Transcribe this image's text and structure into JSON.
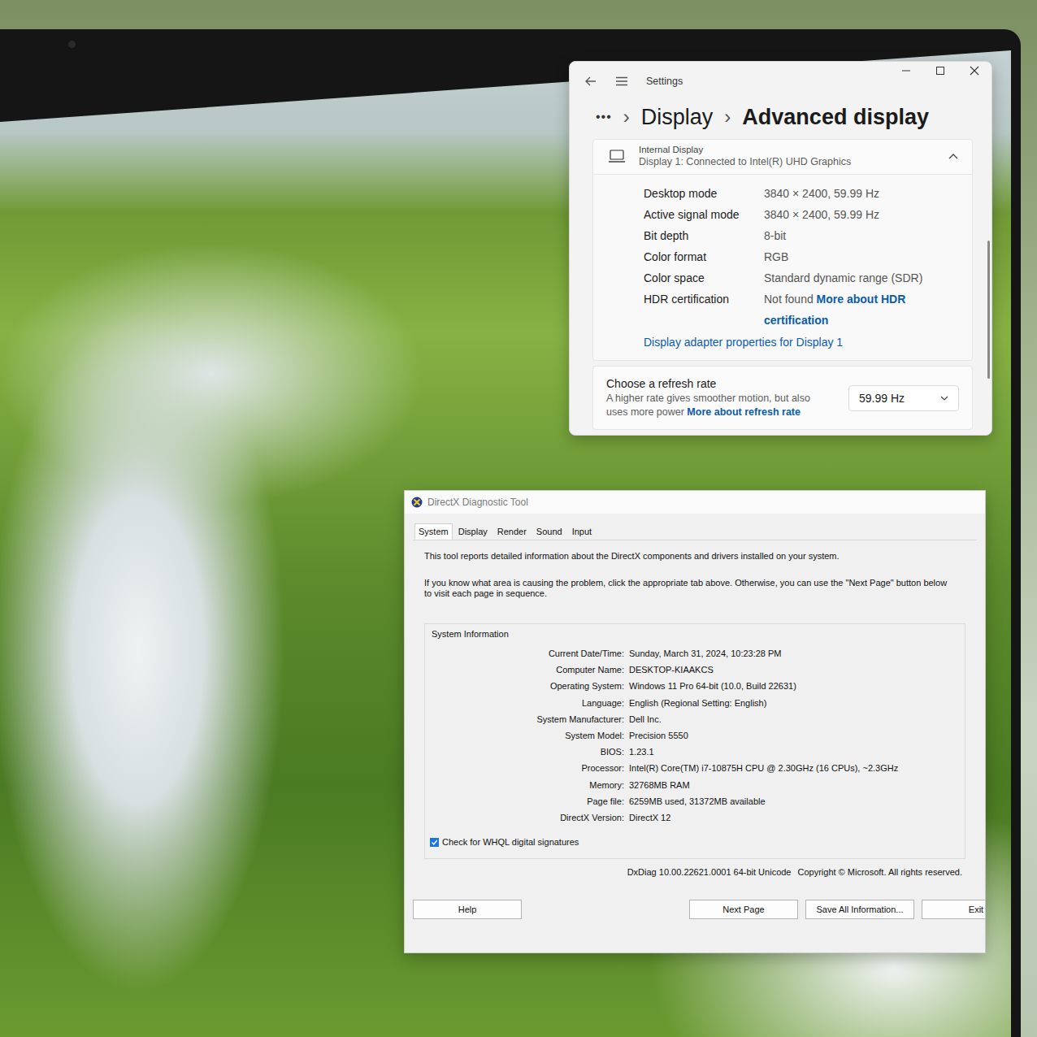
{
  "settings": {
    "title": "Settings",
    "breadcrumb": {
      "more": "•••",
      "separator": "›",
      "parent": "Display",
      "current": "Advanced display"
    },
    "display_card": {
      "title": "Internal Display",
      "subtitle": "Display 1: Connected to Intel(R) UHD Graphics",
      "expanded": true,
      "rows": [
        {
          "label": "Desktop mode",
          "value": "3840 × 2400, 59.99 Hz"
        },
        {
          "label": "Active signal mode",
          "value": "3840 × 2400, 59.99 Hz"
        },
        {
          "label": "Bit depth",
          "value": "8-bit"
        },
        {
          "label": "Color format",
          "value": "RGB"
        },
        {
          "label": "Color space",
          "value": "Standard dynamic range (SDR)"
        },
        {
          "label": "HDR certification",
          "value": "Not found",
          "link": "More about HDR certification"
        }
      ],
      "adapter_link": "Display adapter properties for Display 1"
    },
    "refresh": {
      "title": "Choose a refresh rate",
      "description": "A higher rate gives smoother motion, but also uses more power",
      "link": "More about refresh rate",
      "value": "59.99 Hz"
    }
  },
  "dxdiag": {
    "title": "DirectX Diagnostic Tool",
    "tabs": [
      {
        "label": "System",
        "selected": true
      },
      {
        "label": "Display",
        "selected": false
      },
      {
        "label": "Render",
        "selected": false
      },
      {
        "label": "Sound",
        "selected": false
      },
      {
        "label": "Input",
        "selected": false
      }
    ],
    "intro": "This tool reports detailed information about the DirectX components and drivers installed on your system.",
    "hint": "If you know what area is causing the problem, click the appropriate tab above.  Otherwise, you can use the \"Next Page\" button below to visit each page in sequence.",
    "group_title": "System Information",
    "rows": [
      {
        "label": "Current Date/Time:",
        "value": "Sunday, March 31, 2024, 10:23:28 PM"
      },
      {
        "label": "Computer Name:",
        "value": "DESKTOP-KIAAKCS"
      },
      {
        "label": "Operating System:",
        "value": "Windows 11 Pro 64-bit (10.0, Build 22631)"
      },
      {
        "label": "Language:",
        "value": "English (Regional Setting: English)"
      },
      {
        "label": "System Manufacturer:",
        "value": "Dell Inc."
      },
      {
        "label": "System Model:",
        "value": "Precision 5550"
      },
      {
        "label": "BIOS:",
        "value": "1.23.1"
      },
      {
        "label": "Processor:",
        "value": "Intel(R) Core(TM) i7-10875H CPU @ 2.30GHz (16 CPUs), ~2.3GHz"
      },
      {
        "label": "Memory:",
        "value": "32768MB RAM"
      },
      {
        "label": "Page file:",
        "value": "6259MB used, 31372MB available"
      },
      {
        "label": "DirectX Version:",
        "value": "DirectX 12"
      }
    ],
    "whql": {
      "label": "Check for WHQL digital signatures",
      "checked": true
    },
    "version": "DxDiag 10.00.22621.0001 64-bit Unicode",
    "copyright": "Copyright © Microsoft. All rights reserved.",
    "buttons": [
      "Help",
      "Next Page",
      "Save All Information...",
      "Exit"
    ]
  }
}
